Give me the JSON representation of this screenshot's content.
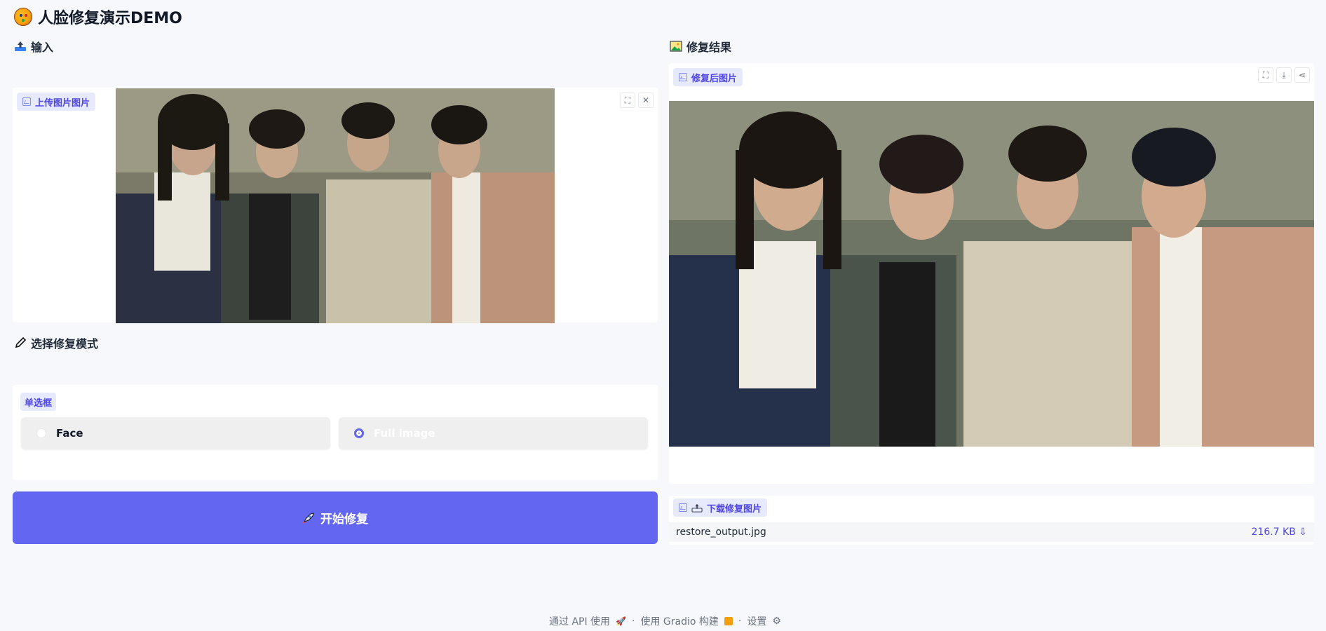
{
  "app": {
    "title": "人脸修复演示DEMO"
  },
  "input": {
    "section_label": "输入",
    "upload_badge": "上传图片图片",
    "icons": [
      "upload-icon",
      "image-icon",
      "fullscreen-icon",
      "close-icon"
    ]
  },
  "mode": {
    "section_label": "选择修复模式",
    "radio_badge": "单选框",
    "options": [
      "Face",
      "Full image"
    ],
    "selected": "Full image"
  },
  "actions": {
    "start_label": "开始修复"
  },
  "result": {
    "section_label": "修复结果",
    "image_badge": "修复后图片",
    "icons": [
      "fullscreen-icon",
      "download-icon",
      "share-icon"
    ]
  },
  "download": {
    "badge": "下载修复图片",
    "file_name": "restore_output.jpg",
    "file_size": "216.7 KB ⇩"
  },
  "footer": {
    "api": "通过 API 使用",
    "sep1": "·",
    "gradio": "使用 Gradio 构建",
    "sep2": "·",
    "settings": "设置"
  },
  "colors": {
    "accent": "#6366f1",
    "badge_bg": "#e7e9fd",
    "page_bg": "#f7f8fb"
  }
}
